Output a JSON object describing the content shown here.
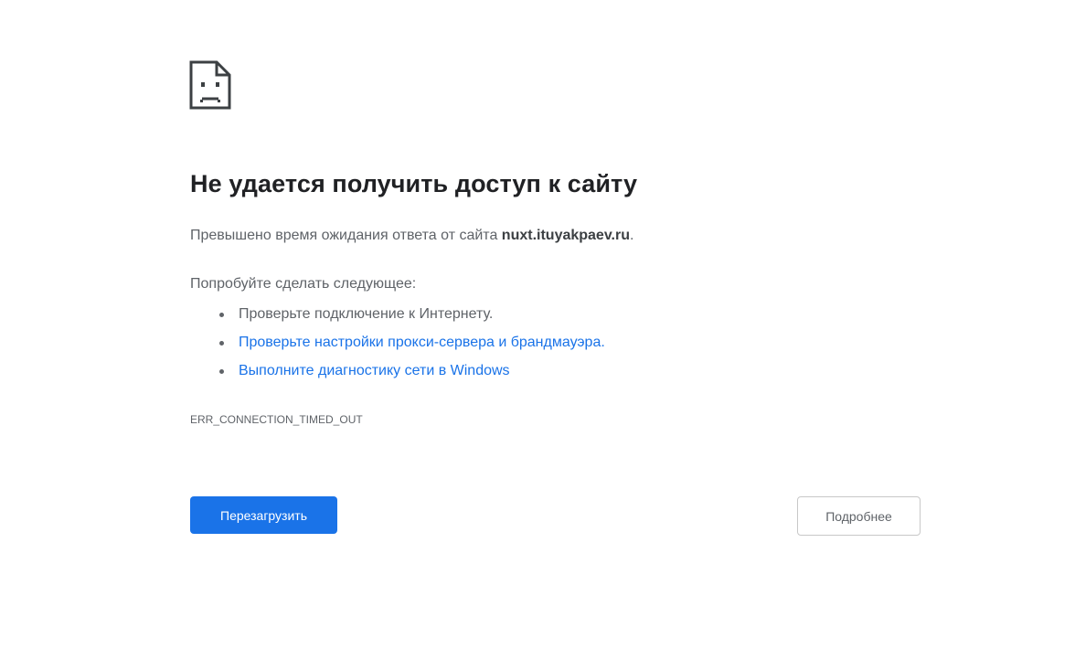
{
  "error_page": {
    "icon": "sad-page-icon",
    "title": "Не удается получить доступ к сайту",
    "summary_prefix": "Превышено время ожидания ответа от сайта ",
    "summary_host": "nuxt.ituyakpaev.ru",
    "summary_suffix": ".",
    "suggestions_heading": "Попробуйте сделать следующее:",
    "suggestions": [
      {
        "label": "Проверьте подключение к Интернету.",
        "is_link": false
      },
      {
        "label": "Проверьте настройки прокси-сервера и брандмауэра.",
        "is_link": true
      },
      {
        "label": "Выполните диагностику сети в Windows",
        "is_link": true
      }
    ],
    "error_code": "ERR_CONNECTION_TIMED_OUT",
    "reload_label": "Перезагрузить",
    "details_label": "Подробнее"
  },
  "colors": {
    "accent": "#1a73e8",
    "text_primary": "#202124",
    "text_secondary": "#5f6368"
  }
}
